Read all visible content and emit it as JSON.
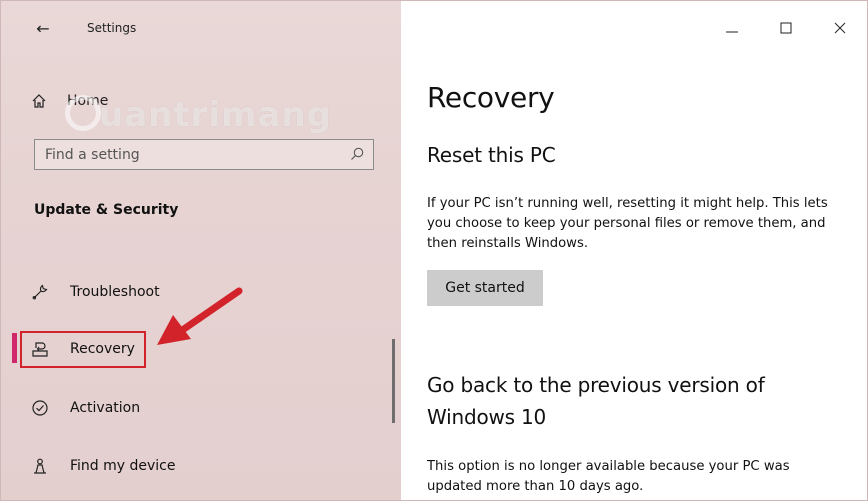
{
  "titlebar": {
    "back_glyph": "←",
    "app_title": "Settings",
    "controls": [
      "minimize-icon",
      "maximize-icon",
      "close-icon"
    ]
  },
  "sidebar": {
    "home_label": "Home",
    "search": {
      "placeholder": "Find a setting",
      "value": ""
    },
    "section_heading": "Update & Security",
    "items": [
      {
        "label": "Troubleshoot",
        "icon": "wrench-icon"
      },
      {
        "label": "Recovery",
        "icon": "recovery-icon",
        "selected": true
      },
      {
        "label": "Activation",
        "icon": "check-circle-icon"
      },
      {
        "label": "Find my device",
        "icon": "person-location-icon"
      }
    ],
    "accent_color": "#d0286a"
  },
  "watermark": {
    "text": "uantrimang"
  },
  "main": {
    "page_title": "Recovery",
    "reset": {
      "heading": "Reset this PC",
      "description": "If your PC isn’t running well, resetting it might help. This lets you choose to keep your personal files or remove them, and then reinstalls Windows.",
      "button_label": "Get started"
    },
    "go_back": {
      "heading": "Go back to the previous version of Windows 10",
      "description": "This option is no longer available because your PC was updated more than 10 days ago."
    }
  },
  "annotation_color": "#d3232a"
}
